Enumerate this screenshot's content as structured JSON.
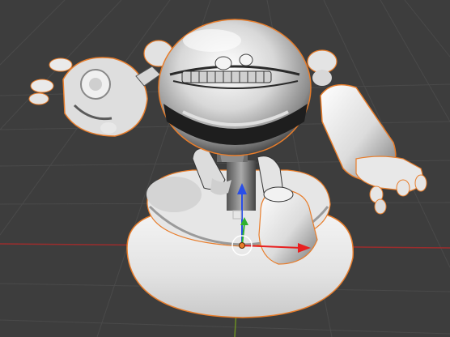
{
  "viewport": {
    "background": "#3d3d3d",
    "grid_color": "#4a4a4a",
    "x_axis_color": "#9b2d2d",
    "y_axis_color": "#6b8e23",
    "selection_outline_color": "#e87d2b",
    "object": "robot-mesh",
    "object_selected": true,
    "transform_gizmo": {
      "mode": "translate",
      "x_color": "#e82020",
      "y_color": "#2fb22f",
      "z_color": "#2a4fe8"
    }
  }
}
